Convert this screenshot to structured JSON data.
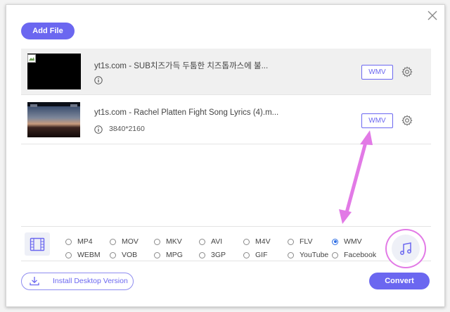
{
  "toolbar": {
    "add_file_label": "Add File"
  },
  "files": [
    {
      "name": "yt1s.com - SUB치즈가득 두툼한 치즈톱까스에 불...",
      "resolution": "",
      "format": "WMV",
      "thumbnail": "broken-image"
    },
    {
      "name": "yt1s.com - Rachel Platten Fight Song Lyrics (4).m...",
      "resolution": "3840*2160",
      "format": "WMV",
      "thumbnail": "sunset-video"
    }
  ],
  "formats": {
    "row1": [
      "MP4",
      "MOV",
      "MKV",
      "AVI",
      "M4V",
      "FLV",
      "WMV"
    ],
    "row2": [
      "WEBM",
      "VOB",
      "MPG",
      "3GP",
      "GIF",
      "YouTube",
      "Facebook"
    ],
    "selected": "WMV"
  },
  "footer": {
    "install_label": "Install Desktop Version",
    "convert_label": "Convert"
  },
  "colors": {
    "accent": "#6b67f0",
    "annotation": "#e27ae6",
    "radio_selected": "#2f6fe5"
  },
  "icons": {
    "close": "close-icon",
    "info": "info-icon",
    "gear": "gear-icon",
    "film": "film-icon",
    "music": "music-note-icon",
    "download": "download-icon"
  }
}
